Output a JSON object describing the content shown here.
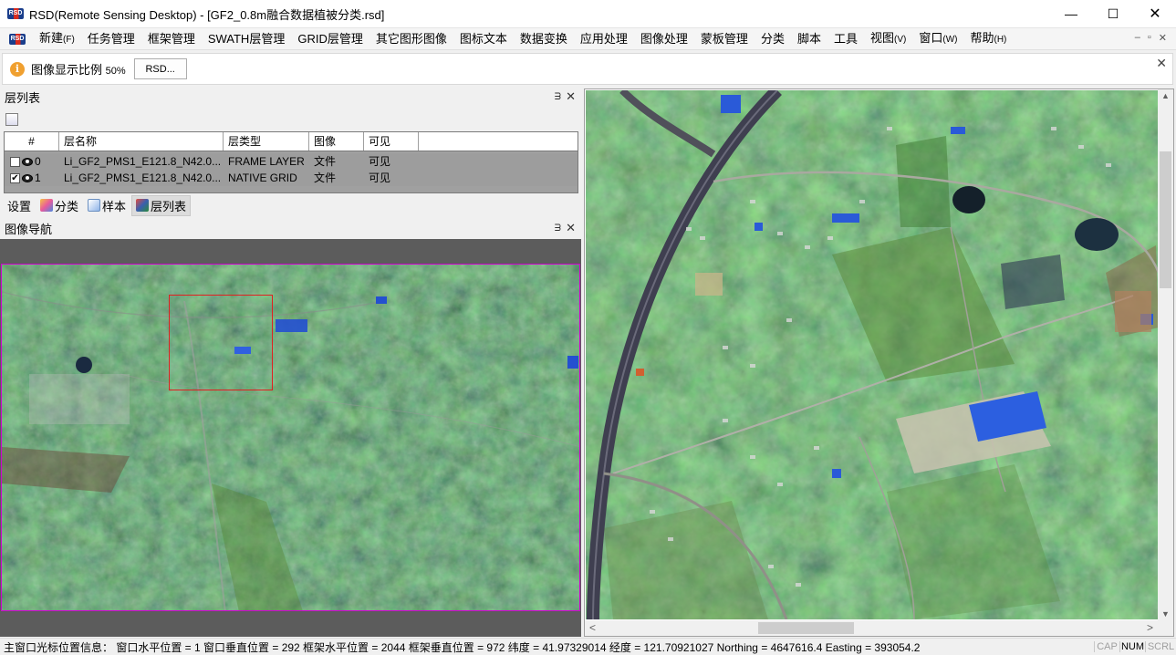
{
  "window": {
    "title": "RSD(Remote Sensing Desktop) - [GF2_0.8m融合数据植被分类.rsd]",
    "logo_text": "RSD",
    "minimize": "—",
    "maximize": "☐",
    "close": "✕"
  },
  "menu": {
    "items": [
      "新建",
      "任务管理",
      "框架管理",
      "SWATH层管理",
      "GRID层管理",
      "其它图形图像",
      "图标文本",
      "数据变换",
      "应用处理",
      "图像处理",
      "蒙板管理",
      "分类",
      "脚本",
      "工具",
      "视图",
      "窗口",
      "帮助"
    ],
    "new_shortcut": "(F)",
    "view_shortcut": "(V)",
    "window_shortcut": "(W)",
    "help_shortcut": "(H)",
    "mdi_min": "–",
    "mdi_restore": "▫",
    "mdi_close": "✕"
  },
  "infobar": {
    "label": "图像显示比例",
    "percent": "50%",
    "button": "RSD...",
    "close": "✕"
  },
  "layer_panel": {
    "title": "层列表",
    "pin": "ᗱ",
    "close": "✕",
    "columns": [
      "#",
      "层名称",
      "层类型",
      "图像",
      "可见"
    ],
    "rows": [
      {
        "checked": false,
        "index": "0",
        "name": "Li_GF2_PMS1_E121.8_N42.0...",
        "type": "FRAME LAYER",
        "image": "文件",
        "visible": "可见"
      },
      {
        "checked": true,
        "index": "1",
        "name": "Li_GF2_PMS1_E121.8_N42.0...",
        "type": "NATIVE GRID",
        "image": "文件",
        "visible": "可见"
      }
    ]
  },
  "tabs": {
    "settings": "设置",
    "classify": "分类",
    "sample": "样本",
    "layers": "层列表"
  },
  "nav_panel": {
    "title": "图像导航",
    "pin": "ᗱ",
    "close": "✕"
  },
  "statusbar": {
    "text": "主窗口光标位置信息： 窗口水平位置 = 1 窗口垂直位置 = 292 框架水平位置 = 2044 框架垂直位置 = 972 纬度 = 41.97329014 经度 = 121.70921027 Northing = 4647616.4 Easting = 393054.2",
    "cap": "CAP",
    "num": "NUM",
    "scrl": "SCRL"
  },
  "colors": {
    "nav_border": "#d000d0",
    "nav_box": "#e02020",
    "table_bg": "#9d9d9d"
  }
}
